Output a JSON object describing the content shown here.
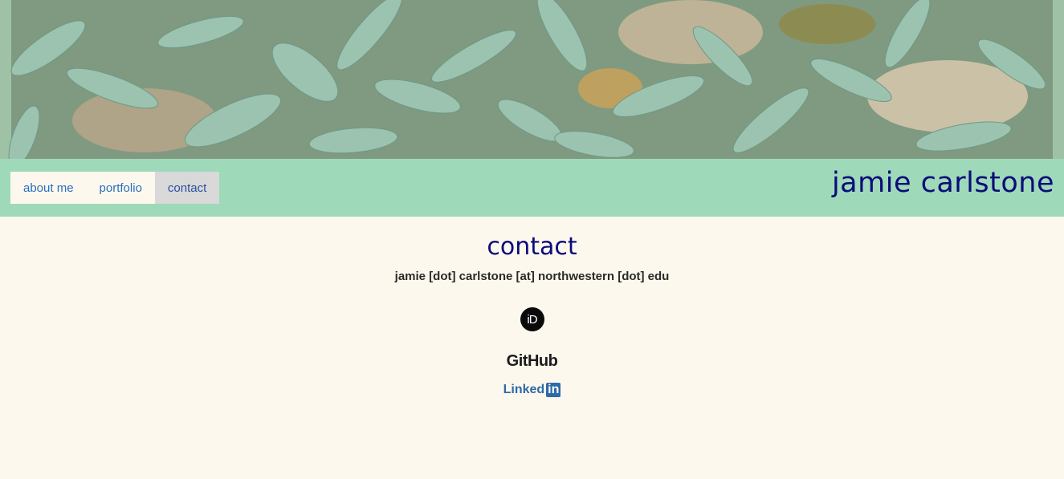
{
  "banner": {
    "image": "plant-leaves-photo"
  },
  "nav": {
    "items": [
      {
        "label": "about me",
        "active": false
      },
      {
        "label": "portfolio",
        "active": false
      },
      {
        "label": "contact",
        "active": true
      }
    ]
  },
  "site": {
    "title": "jamie carlstone"
  },
  "page": {
    "title": "contact",
    "email": "jamie [dot] carlstone [at] northwestern [dot] edu"
  },
  "links": {
    "orcid": {
      "icon": "orcid-icon",
      "label": "iD"
    },
    "github": {
      "icon": "github-logo",
      "label": "GitHub"
    },
    "linkedin": {
      "icon": "linkedin-logo",
      "label_text": "Linked",
      "label_box": "in"
    }
  },
  "colors": {
    "nav_bar": "#9ed9b9",
    "background": "#fdf8ee",
    "title": "#0b0b7a",
    "link": "#2a6fbe"
  }
}
